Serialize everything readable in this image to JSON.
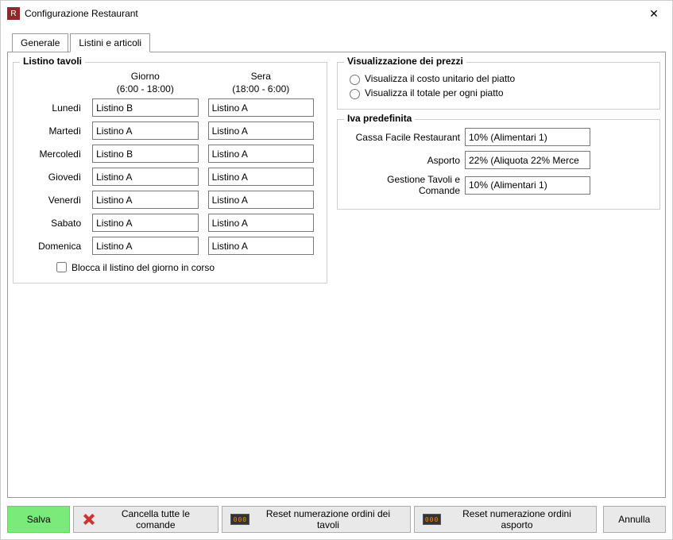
{
  "window": {
    "title": "Configurazione Restaurant",
    "app_icon_text": "R"
  },
  "tabs": {
    "general": "Generale",
    "lists": "Listini e articoli"
  },
  "listino": {
    "legend": "Listino tavoli",
    "header_day": "Giorno",
    "header_day_range": "(6:00 - 18:00)",
    "header_evening": "Sera",
    "header_evening_range": "(18:00 - 6:00)",
    "options": [
      "Listino A",
      "Listino B"
    ],
    "days": [
      {
        "label": "Lunedì",
        "day": "Listino B",
        "evening": "Listino A"
      },
      {
        "label": "Martedì",
        "day": "Listino A",
        "evening": "Listino A"
      },
      {
        "label": "Mercoledì",
        "day": "Listino B",
        "evening": "Listino A"
      },
      {
        "label": "Giovedì",
        "day": "Listino A",
        "evening": "Listino A"
      },
      {
        "label": "Venerdì",
        "day": "Listino A",
        "evening": "Listino A"
      },
      {
        "label": "Sabato",
        "day": "Listino A",
        "evening": "Listino A"
      },
      {
        "label": "Domenica",
        "day": "Listino A",
        "evening": "Listino A"
      }
    ],
    "lock_label": "Blocca il listino del giorno in corso",
    "lock_checked": false
  },
  "visualization": {
    "legend": "Visualizzazione dei prezzi",
    "opt_unit": "Visualizza il costo unitario del piatto",
    "opt_total": "Visualizza il totale per ogni piatto",
    "selected": null
  },
  "iva": {
    "legend": "Iva predefinita",
    "rows": [
      {
        "label": "Cassa Facile Restaurant",
        "value": "10% (Alimentari 1)"
      },
      {
        "label": "Asporto",
        "value": "22% (Aliquota 22% Merce"
      },
      {
        "label": "Gestione Tavoli e Comande",
        "value": "10% (Alimentari 1)"
      }
    ],
    "options": [
      "10% (Alimentari 1)",
      "22% (Aliquota 22% Merce"
    ]
  },
  "buttons": {
    "save": "Salva",
    "delete_orders": "Cancella tutte le comande",
    "reset_tables": "Reset numerazione ordini dei tavoli",
    "reset_takeaway": "Reset numerazione ordini asporto",
    "cancel": "Annulla",
    "counter_text": "000"
  }
}
